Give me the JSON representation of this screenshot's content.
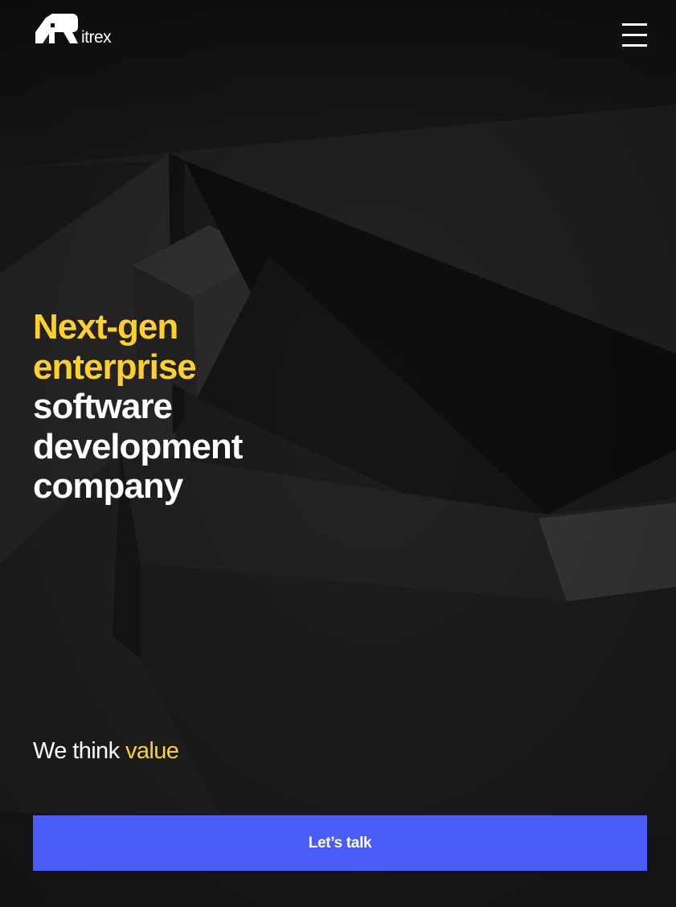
{
  "brand": {
    "name": "itrex",
    "logo_icon": "itrex-r-logo-icon"
  },
  "header": {
    "menu_icon": "hamburger-menu-icon"
  },
  "hero": {
    "title_lines": [
      {
        "text": "Next-gen",
        "highlight": true
      },
      {
        "text": "enterprise",
        "highlight": true
      },
      {
        "text": "software",
        "highlight": false
      },
      {
        "text": "development",
        "highlight": false
      },
      {
        "text": "company",
        "highlight": false
      }
    ],
    "tagline_prefix": "We think",
    "tagline_highlight": "value"
  },
  "cta": {
    "label": "Let’s talk"
  },
  "colors": {
    "background": "#1c1c1c",
    "accent_yellow": "#ffd02b",
    "cta_blue": "#4a5df8",
    "text_white": "#ffffff"
  }
}
